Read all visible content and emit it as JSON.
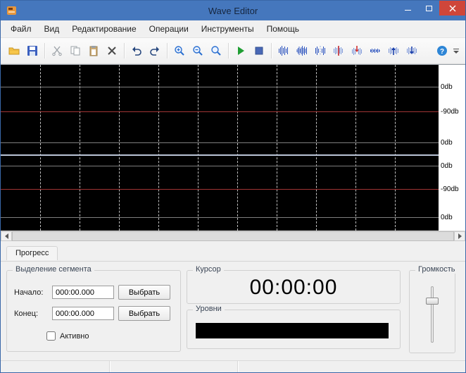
{
  "window": {
    "title": "Wave Editor"
  },
  "menu": {
    "items": [
      "Файл",
      "Вид",
      "Редактирование",
      "Операции",
      "Инструменты",
      "Помощь"
    ]
  },
  "toolbar": {
    "icons": [
      "open-folder",
      "save",
      "cut",
      "copy",
      "paste",
      "delete",
      "undo",
      "redo",
      "zoom-in",
      "zoom-out",
      "zoom-full",
      "play",
      "stop",
      "wave-peak",
      "wave-dense",
      "wave-split",
      "wave-marker",
      "wave-insert",
      "wave-flat",
      "wave-arrow-up",
      "wave-arrow-down",
      "help",
      "overflow-menu"
    ]
  },
  "waveform": {
    "db_labels": [
      "0db",
      "-90db",
      "0db",
      "0db",
      "-90db",
      "0db"
    ]
  },
  "tab": {
    "label": "Прогресс"
  },
  "segment": {
    "title": "Выделение сегмента",
    "start_label": "Начало:",
    "start_value": "000:00.000",
    "end_label": "Конец:",
    "end_value": "000:00.000",
    "select_button": "Выбрать",
    "active_label": "Активно"
  },
  "cursor": {
    "title": "Курсор",
    "value": "00:00:00"
  },
  "levels": {
    "title": "Уровни"
  },
  "volume": {
    "title": "Громкость"
  },
  "colors": {
    "titlebar": "#4577bd",
    "close_button": "#cf463a",
    "wave_background": "#000000",
    "db_line_red": "#a03434",
    "icon_blue": "#2a52be"
  }
}
